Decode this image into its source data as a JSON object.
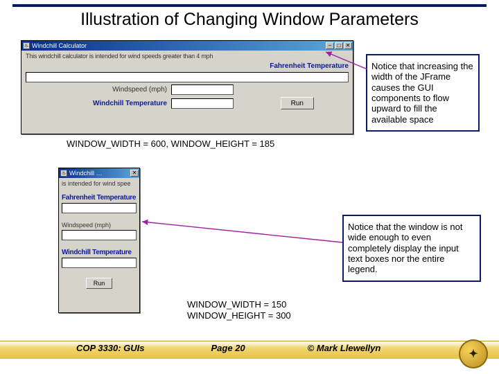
{
  "title": "Illustration of Changing Window Parameters",
  "wide": {
    "winTitle": "Windchill Calculator",
    "legend": "This windchill calculator is intended for wind speeds greater than 4 mph",
    "fahrLabel": "Fahrenheit Temperature",
    "windspeedLabel": "Windspeed (mph)",
    "windchillLabel": "Windchill Temperature",
    "runLabel": "Run",
    "caption": "WINDOW_WIDTH = 600, WINDOW_HEIGHT = 185"
  },
  "narrow": {
    "winTitle": "Windchill …",
    "legendLine": "is intended for wind spee",
    "fahrLabel": "Fahrenheit Temperature",
    "windspeedLabel": "Windspeed (mph)",
    "windchillLabel": "Windchill Temperature",
    "runLabel": "Run",
    "caption": "WINDOW_WIDTH = 150\nWINDOW_HEIGHT = 300"
  },
  "note1": "Notice that increasing the width of the JFrame causes the GUI components to flow upward to fill the available space",
  "note2": "Notice that the window is not wide enough to even completely display the input text boxes nor the entire legend.",
  "footer": {
    "course": "COP 3330:  GUIs",
    "page": "Page 20",
    "copyright": "© Mark Llewellyn"
  },
  "icons": {
    "close": "✕",
    "max": "□",
    "min": "–",
    "java": "♨"
  }
}
